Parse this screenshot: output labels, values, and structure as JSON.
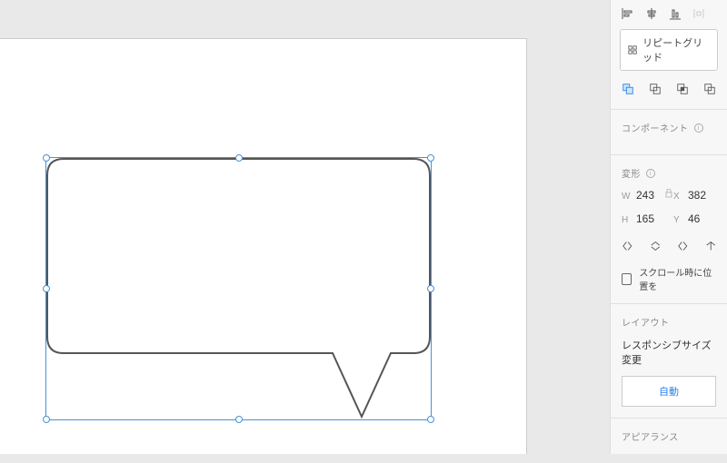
{
  "panel": {
    "repeat_grid_label": "リピートグリッド",
    "component_header": "コンポーネント",
    "transform_header": "変形",
    "w_label": "W",
    "w_value": "243",
    "h_label": "H",
    "h_value": "165",
    "x_label": "X",
    "x_value": "382",
    "y_label": "Y",
    "y_value": "46",
    "fix_scroll_label": "スクロール時に位置を",
    "layout_header": "レイアウト",
    "responsive_label": "レスポンシブサイズ変更",
    "auto_label": "自動",
    "appearance_header": "アピアランス"
  }
}
